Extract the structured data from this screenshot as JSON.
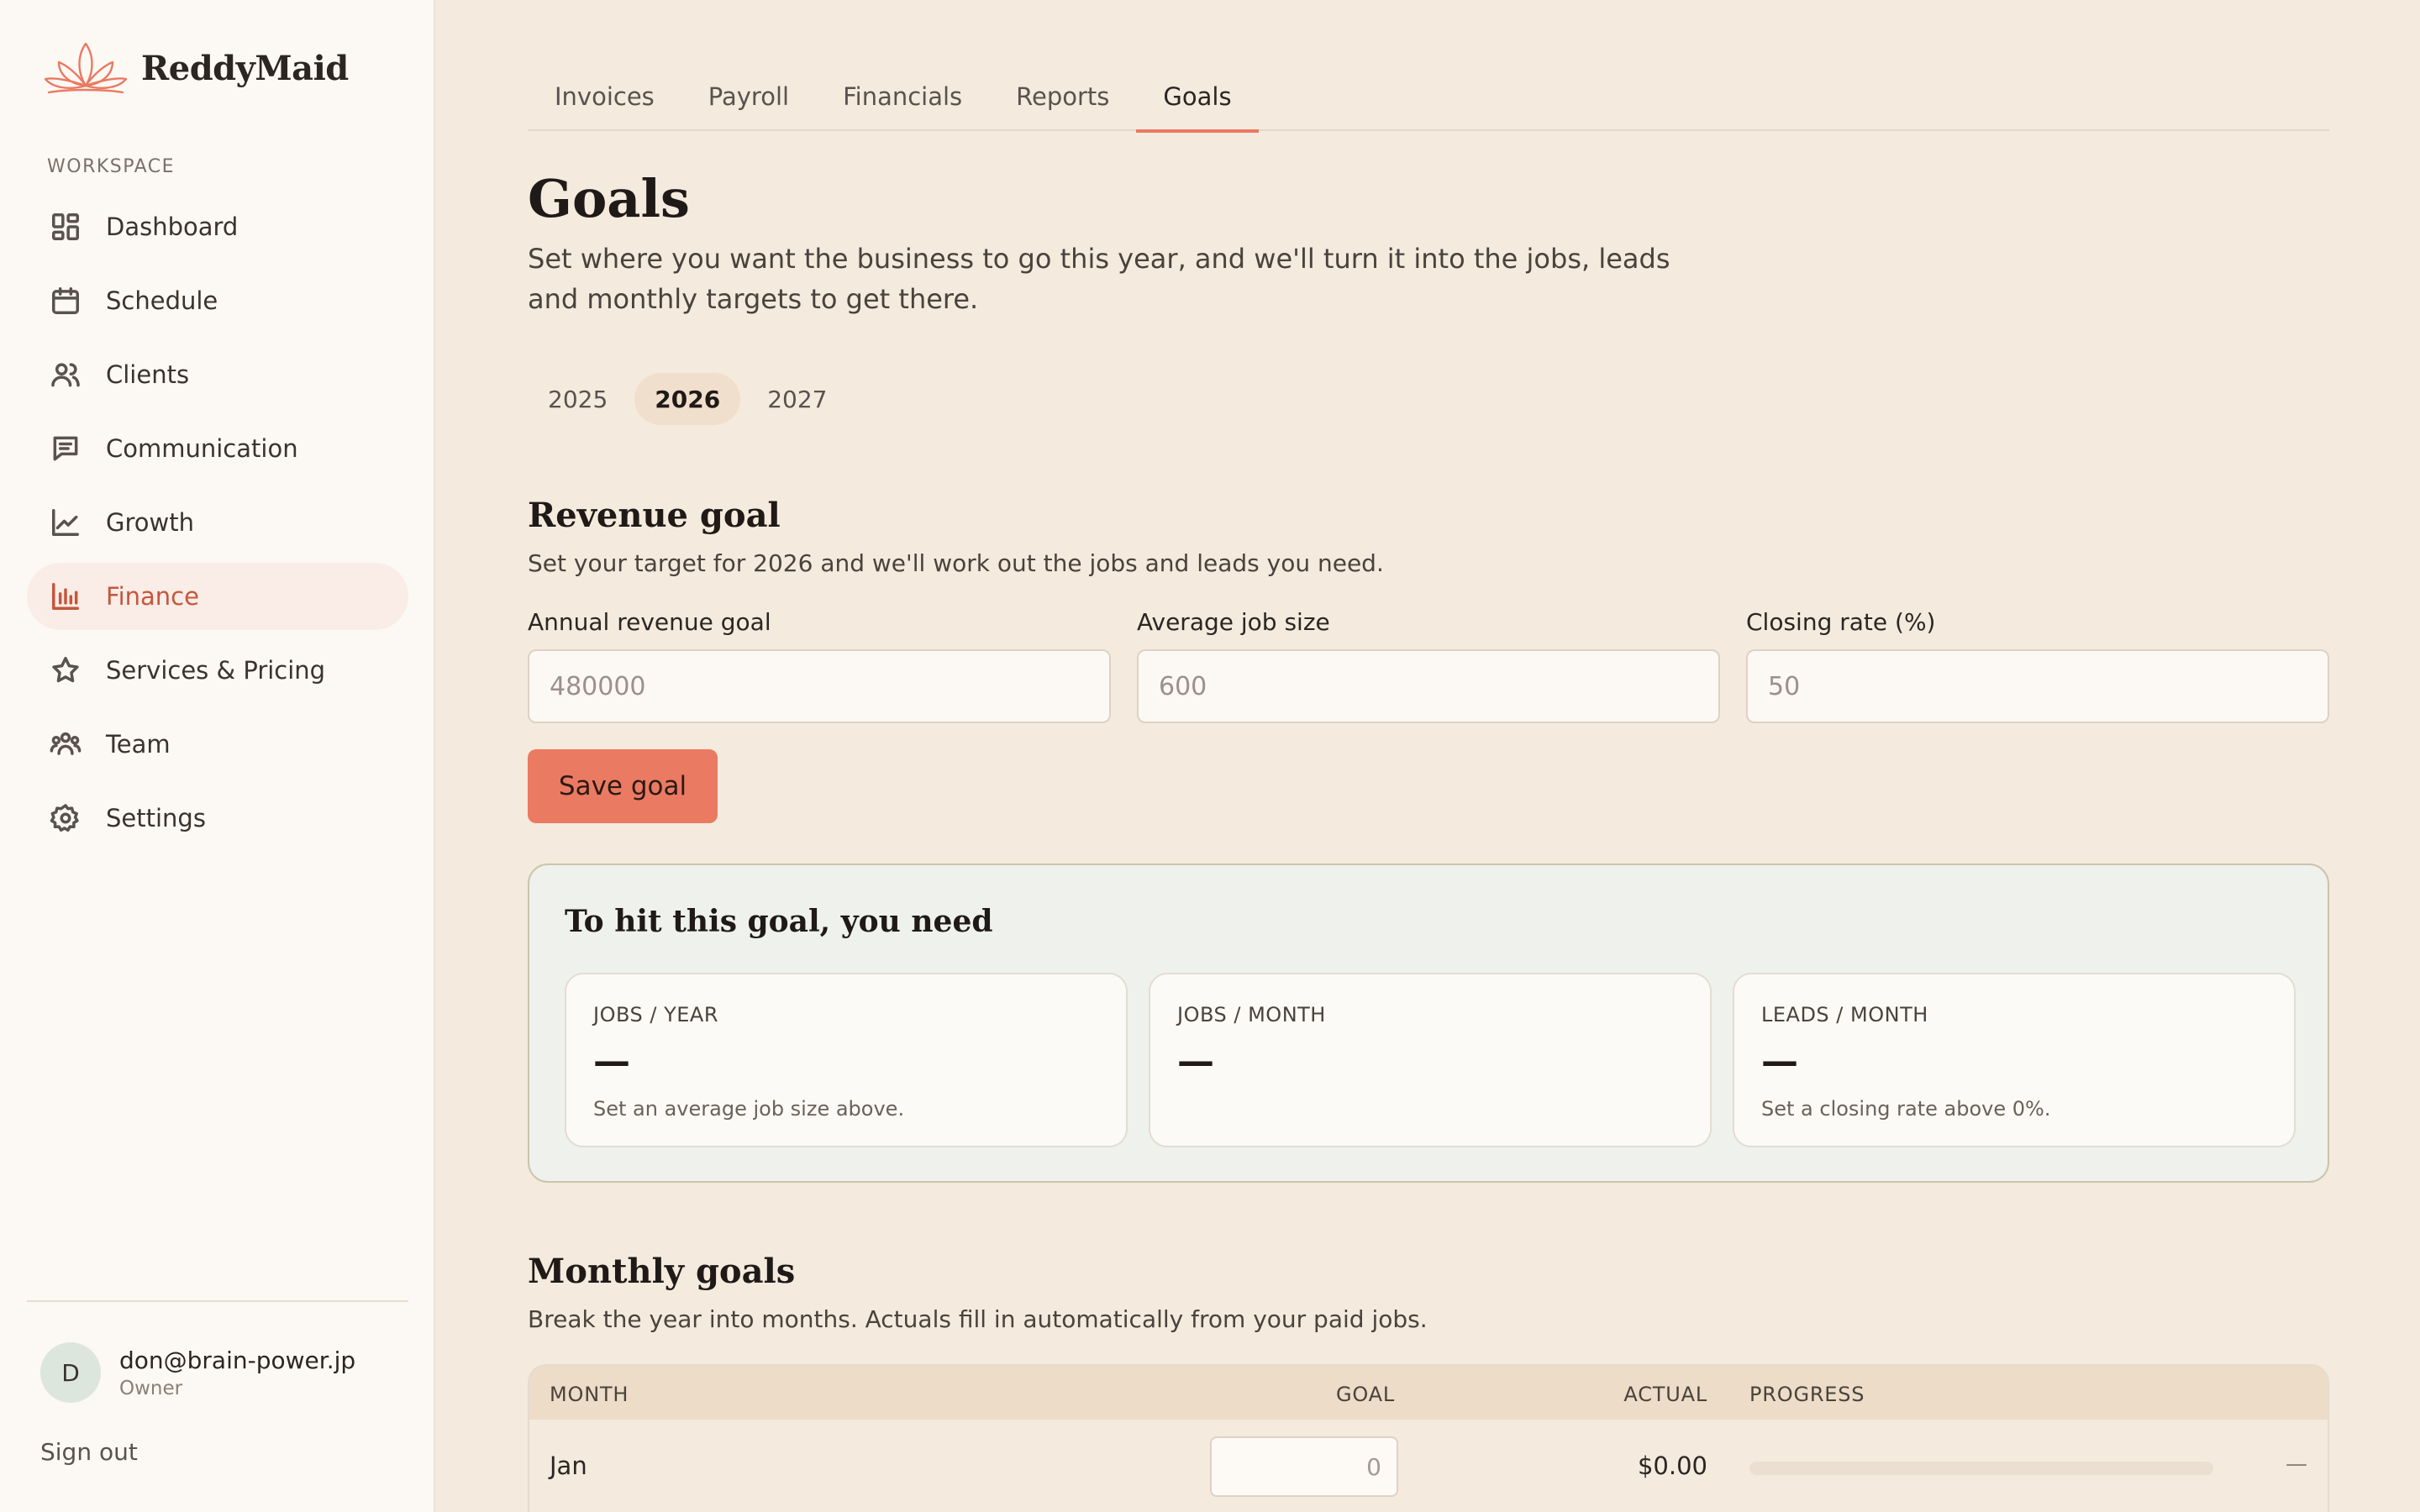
{
  "brand": {
    "name": "ReddyMaid",
    "logo_icon": "lotus-icon",
    "accent": "#ea7a62"
  },
  "sidebar": {
    "section_label": "WORKSPACE",
    "items": [
      {
        "label": "Dashboard",
        "icon": "dashboard-icon"
      },
      {
        "label": "Schedule",
        "icon": "calendar-icon"
      },
      {
        "label": "Clients",
        "icon": "users-icon"
      },
      {
        "label": "Communication",
        "icon": "chat-icon"
      },
      {
        "label": "Growth",
        "icon": "trend-icon"
      },
      {
        "label": "Finance",
        "icon": "bar-chart-icon",
        "active": true
      },
      {
        "label": "Services & Pricing",
        "icon": "star-icon"
      },
      {
        "label": "Team",
        "icon": "team-icon"
      },
      {
        "label": "Settings",
        "icon": "gear-icon"
      }
    ],
    "user": {
      "initial": "D",
      "email": "don@brain-power.jp",
      "role": "Owner"
    },
    "signout_label": "Sign out"
  },
  "tabs": [
    {
      "label": "Invoices"
    },
    {
      "label": "Payroll"
    },
    {
      "label": "Financials"
    },
    {
      "label": "Reports"
    },
    {
      "label": "Goals",
      "active": true
    }
  ],
  "page": {
    "title": "Goals",
    "subtitle": "Set where you want the business to go this year, and we'll turn it into the jobs, leads and monthly targets to get there."
  },
  "years": [
    {
      "label": "2025"
    },
    {
      "label": "2026",
      "active": true
    },
    {
      "label": "2027"
    }
  ],
  "revenue_goal": {
    "title": "Revenue goal",
    "subtitle": "Set your target for 2026 and we'll work out the jobs and leads you need.",
    "fields": {
      "annual": {
        "label": "Annual revenue goal",
        "placeholder": "480000"
      },
      "avg_job": {
        "label": "Average job size",
        "placeholder": "600"
      },
      "closing": {
        "label": "Closing rate (%)",
        "placeholder": "50"
      }
    },
    "save_label": "Save goal"
  },
  "need": {
    "title": "To hit this goal, you need",
    "stats": [
      {
        "label": "JOBS / YEAR",
        "value": "—",
        "note": "Set an average job size above."
      },
      {
        "label": "JOBS / MONTH",
        "value": "—",
        "note": ""
      },
      {
        "label": "LEADS / MONTH",
        "value": "—",
        "note": "Set a closing rate above 0%."
      }
    ]
  },
  "monthly": {
    "title": "Monthly goals",
    "subtitle": "Break the year into months. Actuals fill in automatically from your paid jobs.",
    "columns": {
      "month": "MONTH",
      "goal": "GOAL",
      "actual": "ACTUAL",
      "progress": "PROGRESS"
    },
    "rows": [
      {
        "month": "Jan",
        "goal_placeholder": "0",
        "actual": "$0.00",
        "progress": 0,
        "progress_label": "—"
      }
    ]
  }
}
